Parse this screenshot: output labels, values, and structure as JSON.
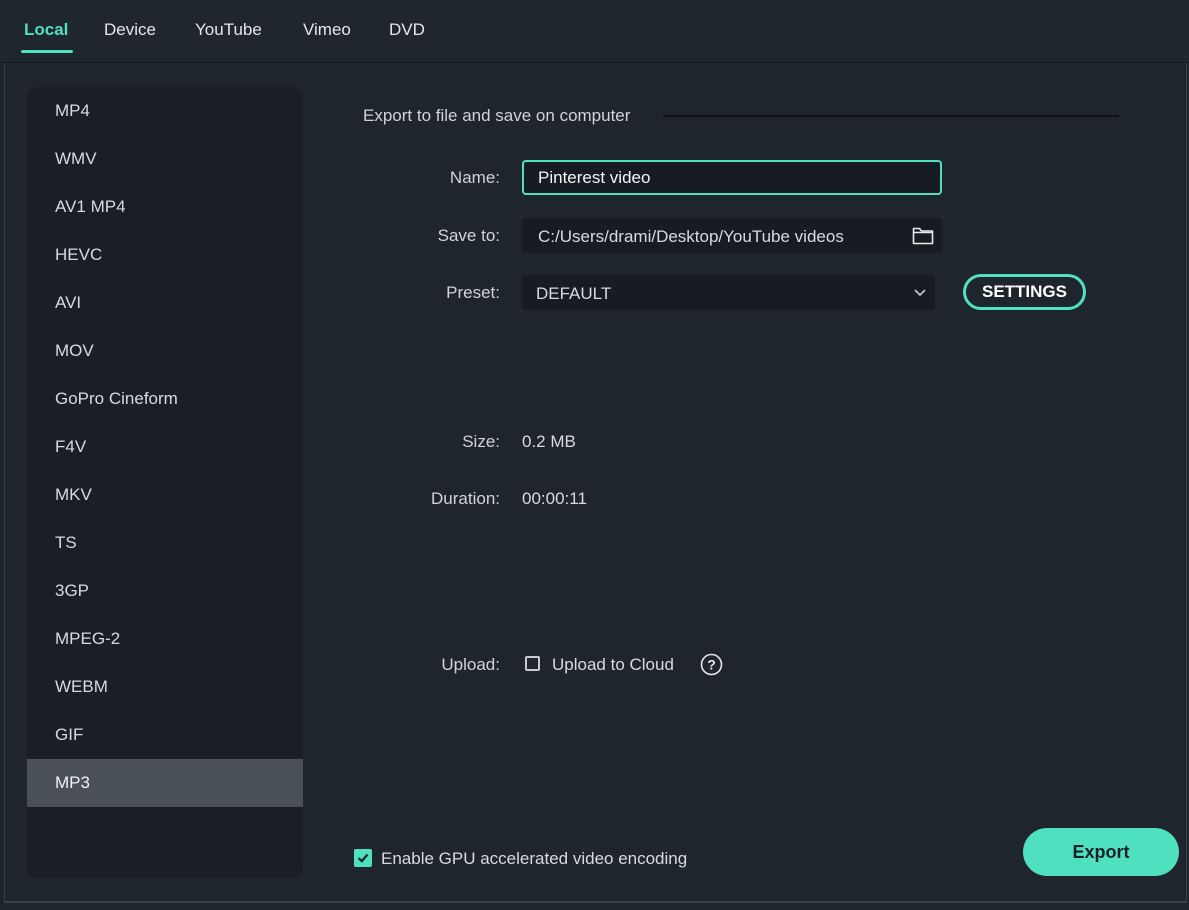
{
  "tabs": [
    "Local",
    "Device",
    "YouTube",
    "Vimeo",
    "DVD"
  ],
  "formats": [
    "MP4",
    "WMV",
    "AV1 MP4",
    "HEVC",
    "AVI",
    "MOV",
    "GoPro Cineform",
    "F4V",
    "MKV",
    "TS",
    "3GP",
    "MPEG-2",
    "WEBM",
    "GIF",
    "MP3"
  ],
  "selected_format": "MP3",
  "export": {
    "section_title": "Export to file and save on computer",
    "name_label": "Name:",
    "name_value": "Pinterest video",
    "save_to_label": "Save to:",
    "save_to_path": "C:/Users/drami/Desktop/YouTube videos",
    "preset_label": "Preset:",
    "preset_value": "DEFAULT",
    "settings_label": "SETTINGS",
    "size_label": "Size:",
    "size_value": "0.2 MB",
    "duration_label": "Duration:",
    "duration_value": "00:00:11",
    "upload_label": "Upload:",
    "upload_checkbox_label": "Upload to Cloud",
    "upload_checked": false
  },
  "gpu": {
    "label": "Enable GPU accelerated video encoding",
    "checked": true
  },
  "export_button": "Export",
  "colors": {
    "accent": "#4fe0c0",
    "background": "#1f252d",
    "sidebar": "#1a1f26",
    "selected_item": "#4a5058"
  }
}
